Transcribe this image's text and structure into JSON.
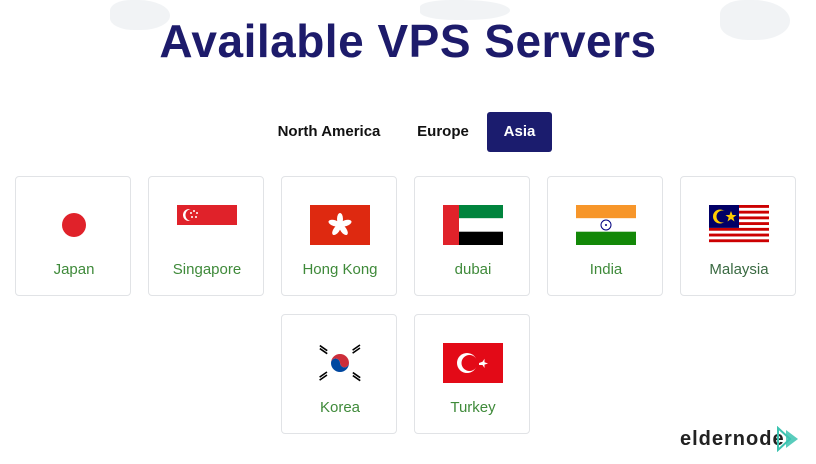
{
  "page": {
    "title": "Available VPS Servers"
  },
  "tabs": [
    {
      "label": "North America",
      "active": false
    },
    {
      "label": "Europe",
      "active": false
    },
    {
      "label": "Asia",
      "active": true
    }
  ],
  "locations": [
    {
      "name": "Japan",
      "flag": "japan-flag"
    },
    {
      "name": "Singapore",
      "flag": "singapore-flag"
    },
    {
      "name": "Hong Kong",
      "flag": "hong-kong-flag"
    },
    {
      "name": "dubai",
      "flag": "uae-flag"
    },
    {
      "name": "India",
      "flag": "india-flag"
    },
    {
      "name": "Malaysia",
      "flag": "malaysia-flag"
    },
    {
      "name": "Korea",
      "flag": "korea-flag"
    },
    {
      "name": "Turkey",
      "flag": "turkey-flag"
    }
  ],
  "brand": {
    "logo_text": "eldernode"
  },
  "colors": {
    "title": "#1d1b6b",
    "active_tab": "#1b1c6e",
    "card_label": "#3f8a3a"
  }
}
